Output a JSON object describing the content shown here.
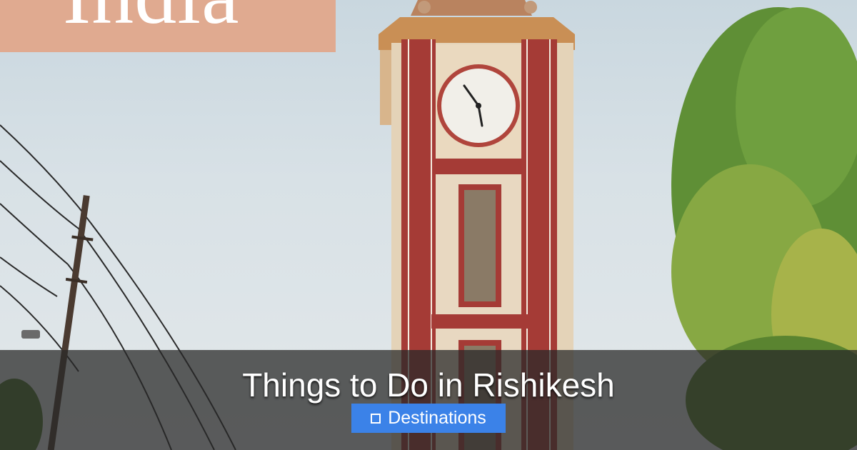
{
  "brand": {
    "text": "India"
  },
  "post": {
    "title": "Things to Do in Rishikesh",
    "category": "Destinations",
    "category_icon": "folder-icon"
  },
  "colors": {
    "brand_box": "#e0aa90",
    "overlay": "#282828",
    "badge": "#3b82e8",
    "tower_red": "#a7403a",
    "tower_cream": "#ead9bf"
  }
}
